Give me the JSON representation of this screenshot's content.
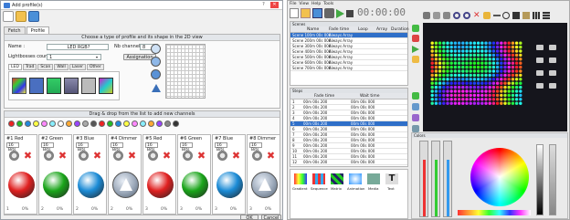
{
  "dialog": {
    "title": "Add profile(s)",
    "help_btn": "?",
    "close_btn": "✕",
    "tabs": [
      "Fetch",
      "Profile"
    ],
    "section_header": "Choose a type of profile and its shape in the 2D view",
    "name_label": "Name :",
    "name_value": "LED RGB?",
    "channels_label": "Nb channels :",
    "channels_value": "8",
    "lightbars_label": "Lightbosses count :",
    "lightbars_value": "1",
    "assign_button": "Assignation",
    "profile_tabs": [
      "LED",
      "Trad",
      "Scan",
      "Wall",
      "Laser",
      "Other"
    ],
    "drop_header": "Drag & drop from the list to add new channels",
    "channels": [
      {
        "name": "#1 Red",
        "bits": "16 Bits",
        "color": "#e02020",
        "shape": "ball",
        "foot_a": "1",
        "foot_b": "0%"
      },
      {
        "name": "#2 Green",
        "bits": "16 Bits",
        "color": "#1aa51a",
        "shape": "ball",
        "foot_a": "2",
        "foot_b": "0%"
      },
      {
        "name": "#3 Blue",
        "bits": "16 Bits",
        "color": "#1b8bd6",
        "shape": "ball",
        "foot_a": "2",
        "foot_b": "0%"
      },
      {
        "name": "#4 Dimmer",
        "bits": "16 Bits",
        "color": "#9aa7b8",
        "shape": "tri",
        "foot_a": "2",
        "foot_b": "0%"
      },
      {
        "name": "#5 Red",
        "bits": "16 Bits",
        "color": "#e02020",
        "shape": "ball",
        "foot_a": "3",
        "foot_b": "0%"
      },
      {
        "name": "#6 Green",
        "bits": "16 Bits",
        "color": "#1aa51a",
        "shape": "ball",
        "foot_a": "3",
        "foot_b": "0%"
      },
      {
        "name": "#7 Blue",
        "bits": "16 Bits",
        "color": "#1b8bd6",
        "shape": "ball",
        "foot_a": "3",
        "foot_b": "0%"
      },
      {
        "name": "#8 Dimmer",
        "bits": "16 Bits",
        "color": "#9aa7b8",
        "shape": "tri",
        "foot_a": "3",
        "foot_b": "0%"
      }
    ],
    "ok": "OK",
    "cancel": "Cancel"
  },
  "app": {
    "menu": [
      "File",
      "View",
      "Help",
      "Tools"
    ],
    "timecode": "00:00:00",
    "scenes_header": "Scenes",
    "scenes_cols": [
      "Name",
      "Fade time",
      "Loop",
      "Array",
      "Duration"
    ],
    "scenes": [
      [
        "Scene 1",
        "00m 00s 000",
        "Always Array",
        "",
        "00s 00.000"
      ],
      [
        "Scene 2",
        "00m 00s 000",
        "Always Array",
        "",
        "00s 00.000"
      ],
      [
        "Scene 3",
        "00m 00s 000",
        "Always Array",
        "",
        "00s 00.000"
      ],
      [
        "Scene 4",
        "00m 00s 000",
        "Always Array",
        "",
        "00s 00.000"
      ],
      [
        "Scene 5",
        "00m 00s 000",
        "Always Array",
        "",
        "00s 00.000"
      ],
      [
        "Scene 6",
        "00m 00s 000",
        "Always Array",
        "",
        "00s 00.000"
      ],
      [
        "Scene 7",
        "00m 00s 000",
        "Always Array",
        "",
        "00s 00.000"
      ]
    ],
    "steps_header": "Steps",
    "steps_cols": [
      "Fade time",
      "Wait time"
    ],
    "steps": [
      [
        "1",
        "00m 00s 200",
        "00m 00s 000"
      ],
      [
        "2",
        "00m 00s 200",
        "00m 00s 000"
      ],
      [
        "3",
        "00m 00s 200",
        "00m 00s 000"
      ],
      [
        "4",
        "00m 00s 200",
        "00m 00s 000"
      ],
      [
        "5",
        "00m 00s 200",
        "00m 00s 000"
      ],
      [
        "6",
        "00m 00s 200",
        "00m 00s 000"
      ],
      [
        "7",
        "00m 00s 200",
        "00m 00s 000"
      ],
      [
        "8",
        "00m 00s 200",
        "00m 00s 000"
      ],
      [
        "9",
        "00m 00s 200",
        "00m 00s 000"
      ],
      [
        "10",
        "00m 00s 200",
        "00m 00s 000"
      ],
      [
        "11",
        "00m 00s 200",
        "00m 00s 000"
      ],
      [
        "12",
        "00m 00s 200",
        "00m 00s 000"
      ]
    ],
    "effects": [
      "Gradient",
      "Sequence",
      "Matrix",
      "Animation",
      "Media",
      "Text"
    ],
    "colors_header": "Colors"
  }
}
